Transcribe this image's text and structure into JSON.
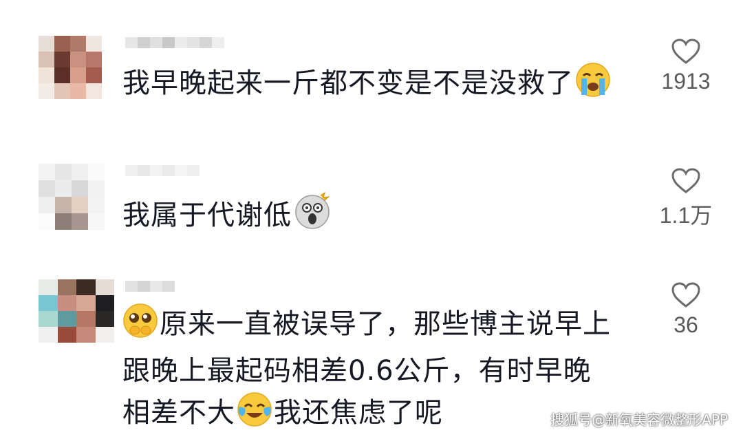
{
  "comments": [
    {
      "text_lines": [
        "我早晚起来一斤都不变是不是没救了"
      ],
      "emoji": "loudly-crying-face",
      "like_count": "1913"
    },
    {
      "text_lines": [
        "我属于代谢低"
      ],
      "emoji": "shocked-face",
      "like_count": "1.1万"
    },
    {
      "prefix_emoji": "pleading-face",
      "text_lines": [
        "原来一直被误导了，那些博主说早上",
        "跟晚上最起码相差0.6公斤，有时早晚",
        "相差不大",
        "我还焦虑了呢"
      ],
      "emoji": "tears-of-joy-face",
      "like_count": "36"
    }
  ],
  "watermark": "搜狐号@新氧美容微整形APP",
  "colors": {
    "text": "#161823",
    "count": "#5a5a5a",
    "heart": "#6b6b6b"
  }
}
